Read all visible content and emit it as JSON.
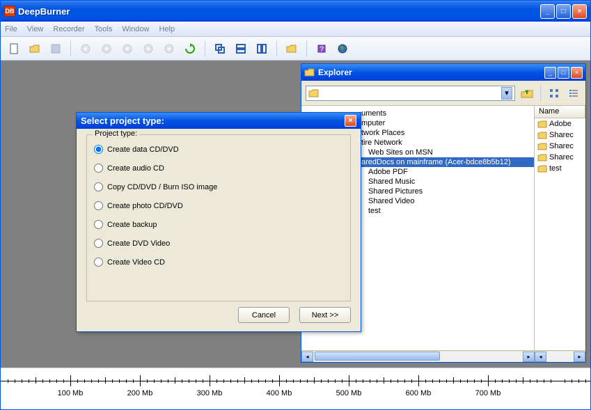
{
  "window": {
    "title": "DeepBurner",
    "app_icon_text": "DB"
  },
  "menu": {
    "items": [
      "File",
      "View",
      "Recorder",
      "Tools",
      "Window",
      "Help"
    ]
  },
  "dialog": {
    "title": "Select project type:",
    "group_label": "Project type:",
    "options": [
      "Create data CD/DVD",
      "Create audio CD",
      "Copy CD/DVD / Burn ISO image",
      "Create photo CD/DVD",
      "Create backup",
      "Create DVD Video",
      "Create Video CD"
    ],
    "selected_index": 0,
    "cancel_label": "Cancel",
    "next_label": "Next >>"
  },
  "explorer": {
    "title": "Explorer",
    "tree_items": [
      {
        "label": "uments",
        "level": 0
      },
      {
        "label": "mputer",
        "level": 0
      },
      {
        "label": "twork Places",
        "level": 0
      },
      {
        "label": "tire Network",
        "level": 0
      },
      {
        "label": "Web Sites on MSN",
        "level": 1
      },
      {
        "label": "aredDocs on mainframe (Acer-bdce8b5b12)",
        "level": 0,
        "selected": true
      },
      {
        "label": "Adobe PDF",
        "level": 1
      },
      {
        "label": "Shared Music",
        "level": 1
      },
      {
        "label": "Shared Pictures",
        "level": 1
      },
      {
        "label": "Shared Video",
        "level": 1
      },
      {
        "label": "test",
        "level": 1
      }
    ],
    "list_header": "Name",
    "list_items": [
      "Adobe",
      "Sharec",
      "Sharec",
      "Sharec",
      "test"
    ]
  },
  "ruler": {
    "ticks": [
      {
        "pos": 100,
        "label": "100 Mb"
      },
      {
        "pos": 200,
        "label": "200 Mb"
      },
      {
        "pos": 300,
        "label": "300 Mb"
      },
      {
        "pos": 400,
        "label": "400 Mb"
      },
      {
        "pos": 500,
        "label": "500 Mb"
      },
      {
        "pos": 600,
        "label": "600 Mb"
      },
      {
        "pos": 700,
        "label": "700 Mb"
      }
    ]
  }
}
